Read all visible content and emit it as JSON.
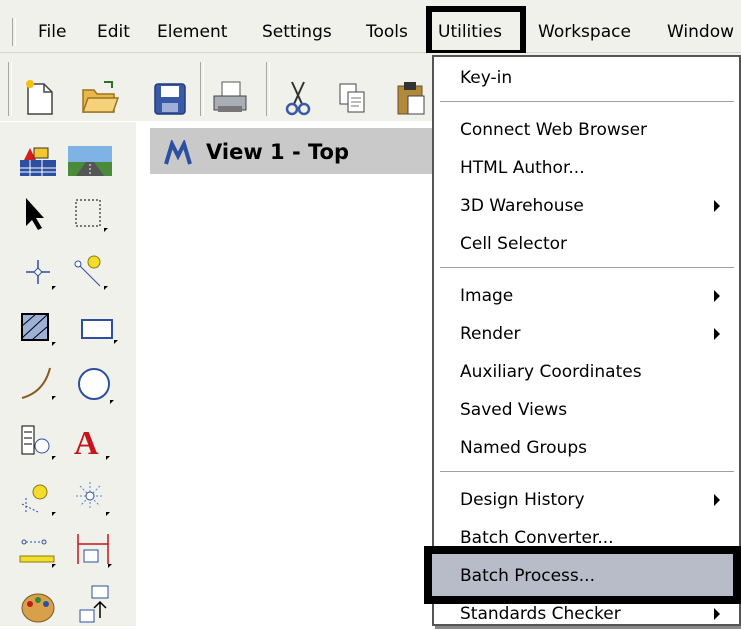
{
  "menubar": {
    "items": [
      "File",
      "Edit",
      "Element",
      "Settings",
      "Tools",
      "Utilities",
      "Workspace",
      "Window"
    ]
  },
  "view": {
    "title": "View 1 - Top"
  },
  "dropdown": {
    "items": [
      {
        "label": "Key-in",
        "submenu": false
      },
      {
        "label": "Connect Web Browser",
        "submenu": false
      },
      {
        "label": "HTML Author...",
        "submenu": false
      },
      {
        "label": "3D Warehouse",
        "submenu": true
      },
      {
        "label": "Cell Selector",
        "submenu": false
      },
      {
        "label": "Image",
        "submenu": true
      },
      {
        "label": "Render",
        "submenu": true
      },
      {
        "label": "Auxiliary Coordinates",
        "submenu": false
      },
      {
        "label": "Saved Views",
        "submenu": false
      },
      {
        "label": "Named Groups",
        "submenu": false
      },
      {
        "label": "Design History",
        "submenu": true
      },
      {
        "label": "Batch Converter...",
        "submenu": false
      },
      {
        "label": "Batch Process...",
        "submenu": false,
        "highlighted": true
      },
      {
        "label": "Standards Checker",
        "submenu": true
      }
    ]
  },
  "colors": {
    "menubar_bg": "#f1f1ec",
    "highlight": "#b8bcc8",
    "view_title_bg": "#c9c9c9"
  },
  "icons": [
    "new-file-icon",
    "open-folder-icon",
    "save-icon",
    "print-icon",
    "cut-icon",
    "copy-icon",
    "paste-icon"
  ]
}
